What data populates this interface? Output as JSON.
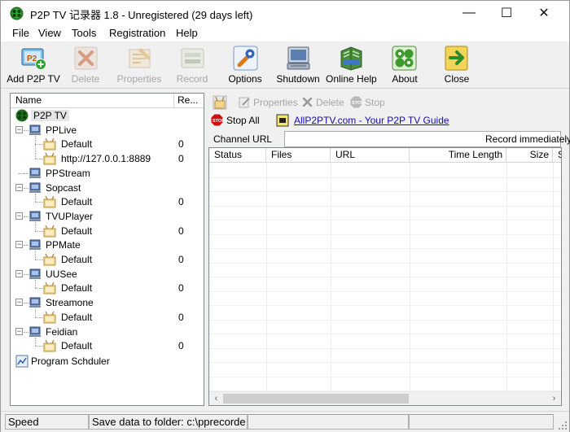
{
  "window": {
    "title": "P2P TV 记录器 1.8  - Unregistered (29 days left)",
    "controls": {
      "minimize": "—",
      "maximize": "☐",
      "close": "✕"
    }
  },
  "menu": [
    "File",
    "View",
    "Tools",
    "Registration",
    "Help"
  ],
  "toolbar": [
    {
      "label": "Add P2P TV",
      "icon": "add-tv-icon",
      "enabled": true
    },
    {
      "label": "Delete",
      "icon": "delete-x-icon",
      "enabled": false
    },
    {
      "label": "Properties",
      "icon": "properties-icon",
      "enabled": false
    },
    {
      "label": "Record",
      "icon": "record-icon",
      "enabled": false
    },
    {
      "label": "Options",
      "icon": "options-wrench-icon",
      "enabled": true
    },
    {
      "label": "Shutdown",
      "icon": "shutdown-computer-icon",
      "enabled": true
    },
    {
      "label": "Online Help",
      "icon": "help-book-icon",
      "enabled": true
    },
    {
      "label": "About",
      "icon": "about-icon",
      "enabled": true
    },
    {
      "label": "Close",
      "icon": "close-door-icon",
      "enabled": true
    }
  ],
  "tree": {
    "headers": {
      "name": "Name",
      "re": "Re..."
    },
    "root": "P2P TV",
    "groups": [
      {
        "name": "PPLive",
        "children": [
          {
            "name": "Default",
            "value": "0"
          },
          {
            "name": "http://127.0.0.1:8889",
            "value": "0"
          }
        ]
      },
      {
        "name": "PPStream",
        "children": []
      },
      {
        "name": "Sopcast",
        "children": [
          {
            "name": "Default",
            "value": "0"
          }
        ]
      },
      {
        "name": "TVUPlayer",
        "children": [
          {
            "name": "Default",
            "value": "0"
          }
        ]
      },
      {
        "name": "PPMate",
        "children": [
          {
            "name": "Default",
            "value": "0"
          }
        ]
      },
      {
        "name": "UUSee",
        "children": [
          {
            "name": "Default",
            "value": "0"
          }
        ]
      },
      {
        "name": "Streamone",
        "children": [
          {
            "name": "Default",
            "value": "0"
          }
        ]
      },
      {
        "name": "Feidian",
        "children": [
          {
            "name": "Default",
            "value": "0"
          }
        ]
      }
    ],
    "scheduler": "Program Schduler"
  },
  "right_toolbar": {
    "properties": "Properties",
    "delete": "Delete",
    "stop": "Stop",
    "stop_all": "Stop All",
    "guide_link": "AllP2PTV.com - Your P2P TV Guide"
  },
  "channel": {
    "label": "Channel URL",
    "value": "",
    "record_label": "Record immediately"
  },
  "list": {
    "columns": [
      "Status",
      "Files",
      "URL",
      "Time Length",
      "Size",
      "S"
    ]
  },
  "statusbar": {
    "speed": "Speed",
    "folder": "Save data to folder: c:\\pprecorde"
  },
  "colors": {
    "disabled_text": "#a6a6a6",
    "link": "#1a0dab",
    "stop_red": "#d01010"
  }
}
